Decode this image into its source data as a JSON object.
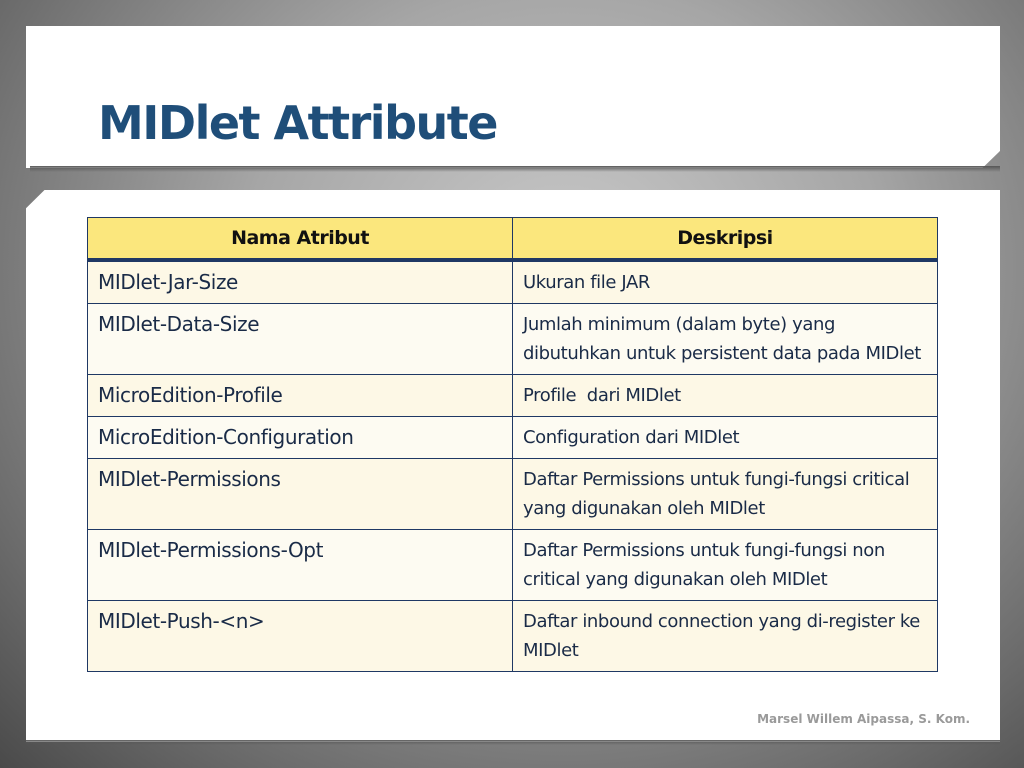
{
  "slide": {
    "title": "MIDlet Attribute",
    "footer": "Marsel Willem Aipassa, S. Kom."
  },
  "table": {
    "headers": [
      "Nama Atribut",
      "Deskripsi"
    ],
    "rows": [
      {
        "name": "MIDlet-Jar-Size",
        "description": "Ukuran file JAR"
      },
      {
        "name": "MIDlet-Data-Size",
        "description": "Jumlah minimum (dalam byte) yang dibutuhkan untuk persistent data pada MIDlet"
      },
      {
        "name": "MicroEdition-Profile",
        "description": "Profile  dari MIDlet"
      },
      {
        "name": "MicroEdition-Configuration",
        "description": "Configuration dari MIDlet"
      },
      {
        "name": "MIDlet-Permissions",
        "description": "Daftar Permissions untuk fungi-fungsi critical yang digunakan oleh MIDlet"
      },
      {
        "name": "MIDlet-Permissions-Opt",
        "description": "Daftar Permissions untuk fungi-fungsi non critical yang digunakan oleh MIDlet"
      },
      {
        "name": "MIDlet-Push-<n>",
        "description": "Daftar inbound connection yang di-register ke MIDlet"
      }
    ]
  },
  "colors": {
    "title": "#1f4e79",
    "header_fill": "#fbe77d",
    "row_fill": "#fdf8e6",
    "border": "#1f3864"
  }
}
